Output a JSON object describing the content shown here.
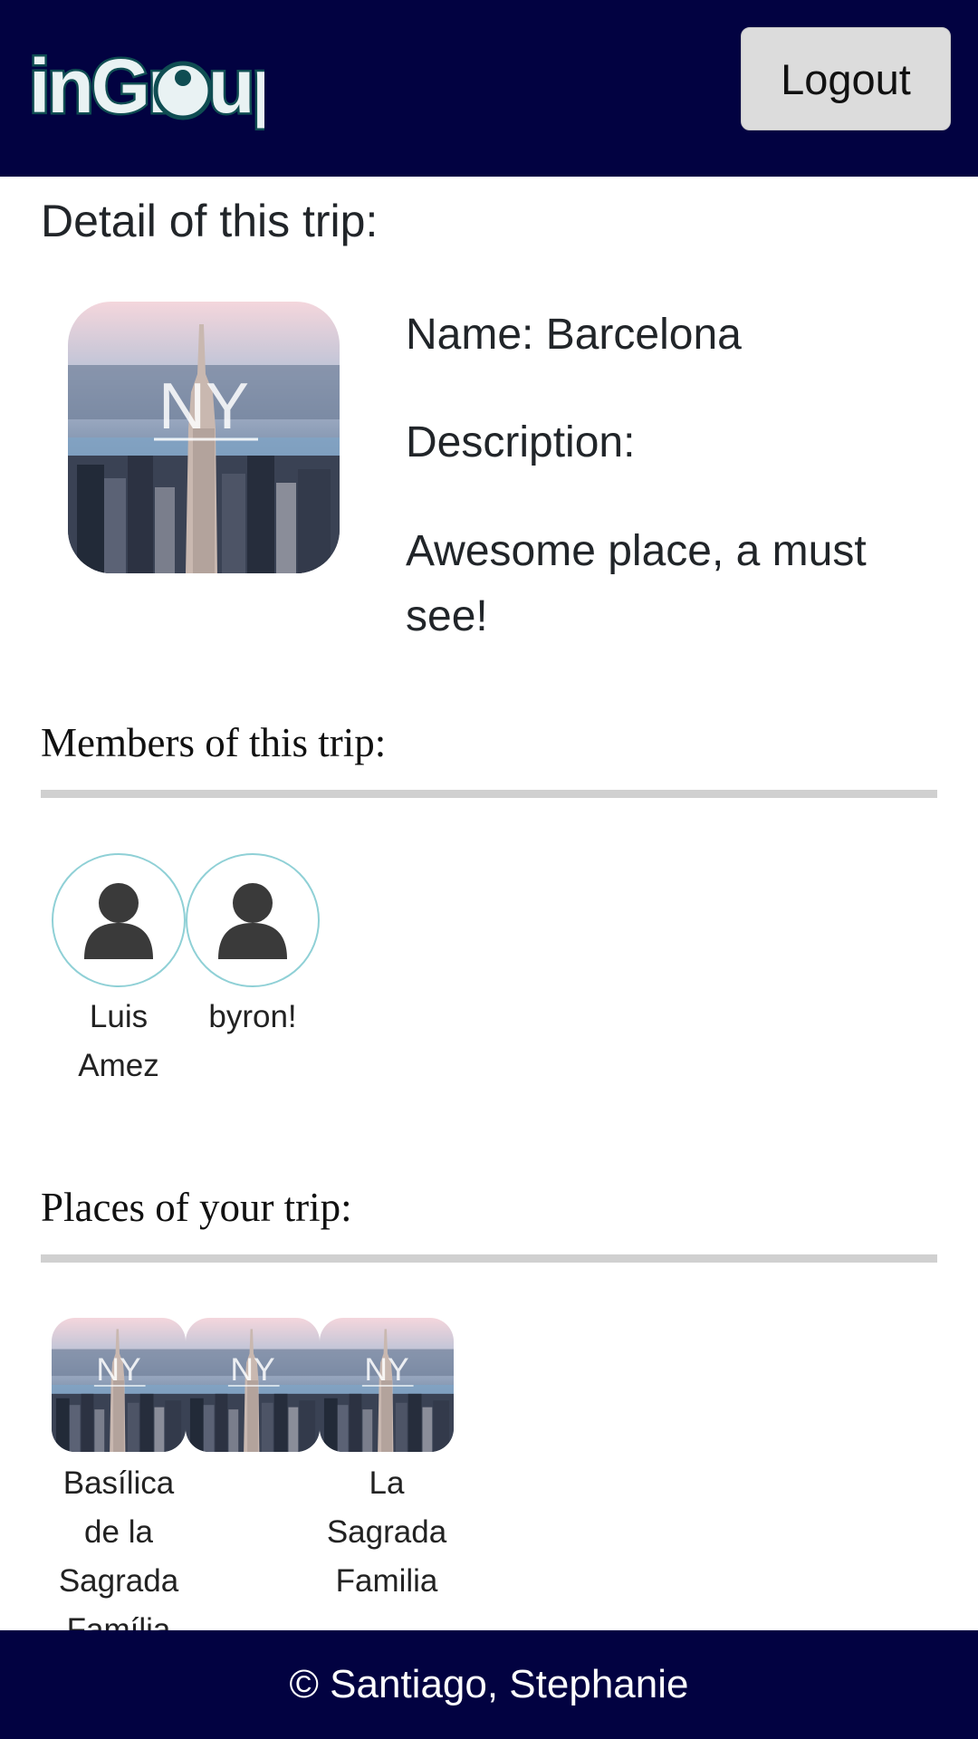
{
  "header": {
    "logo_text": "inGroup",
    "logout_label": "Logout"
  },
  "trip": {
    "heading": "Detail of this trip:",
    "image_label": "NY",
    "name_line": "Name: Barcelona",
    "description_label": "Description:",
    "description_text": "Awesome place, a must see!"
  },
  "members": {
    "heading": "Members of this trip:",
    "items": [
      {
        "name": "Luis Amez",
        "icon": "user-avatar-icon"
      },
      {
        "name": "byron!",
        "icon": "user-avatar-icon"
      }
    ]
  },
  "places": {
    "heading": "Places of your trip:",
    "items": [
      {
        "name": "Basílica de la Sagrada Família",
        "image_label": "NY"
      },
      {
        "name": "",
        "image_label": "NY"
      },
      {
        "name": "La Sagrada Familia",
        "image_label": "NY"
      }
    ]
  },
  "footer": {
    "text": "© Santiago, Stephanie"
  },
  "colors": {
    "navbar": "#020241",
    "avatar_border": "#8fd0d6",
    "divider": "#d0d0d0"
  }
}
